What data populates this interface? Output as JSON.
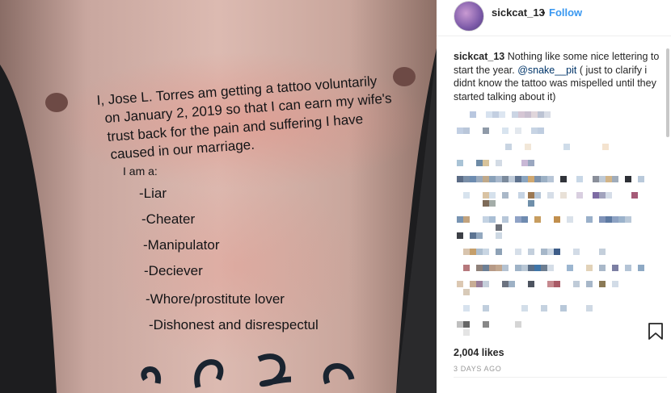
{
  "post": {
    "username": "sickcat_13",
    "separator": "•",
    "follow_label": "Follow",
    "caption_username": "sickcat_13",
    "caption_text_1": "Nothing like some nice lettering to start the year. ",
    "caption_mention": "@snake__pit",
    "caption_text_2": " ( just to clarify i didnt know the tattoo was mispelled until they started talking about it)",
    "likes": "2,004 likes",
    "time_ago": "3 DAYS AGO"
  },
  "photo": {
    "tattoo_lines": [
      "I, Jose L. Torres  am getting a tattoo voluntarily",
      "on January 2, 2019 so that I can earn my wife's",
      "trust back for the pain and suffering I have",
      "caused in our marriage."
    ],
    "tattoo_iam": "I am a:",
    "tattoo_list": [
      "-Liar",
      "-Cheater",
      "-Manipulator",
      "-Deciever",
      "-Whore/prostitute lover",
      "-Dishonest and disrespectul"
    ]
  },
  "icons": {
    "bookmark": "bookmark-icon",
    "avatar": "avatar"
  }
}
